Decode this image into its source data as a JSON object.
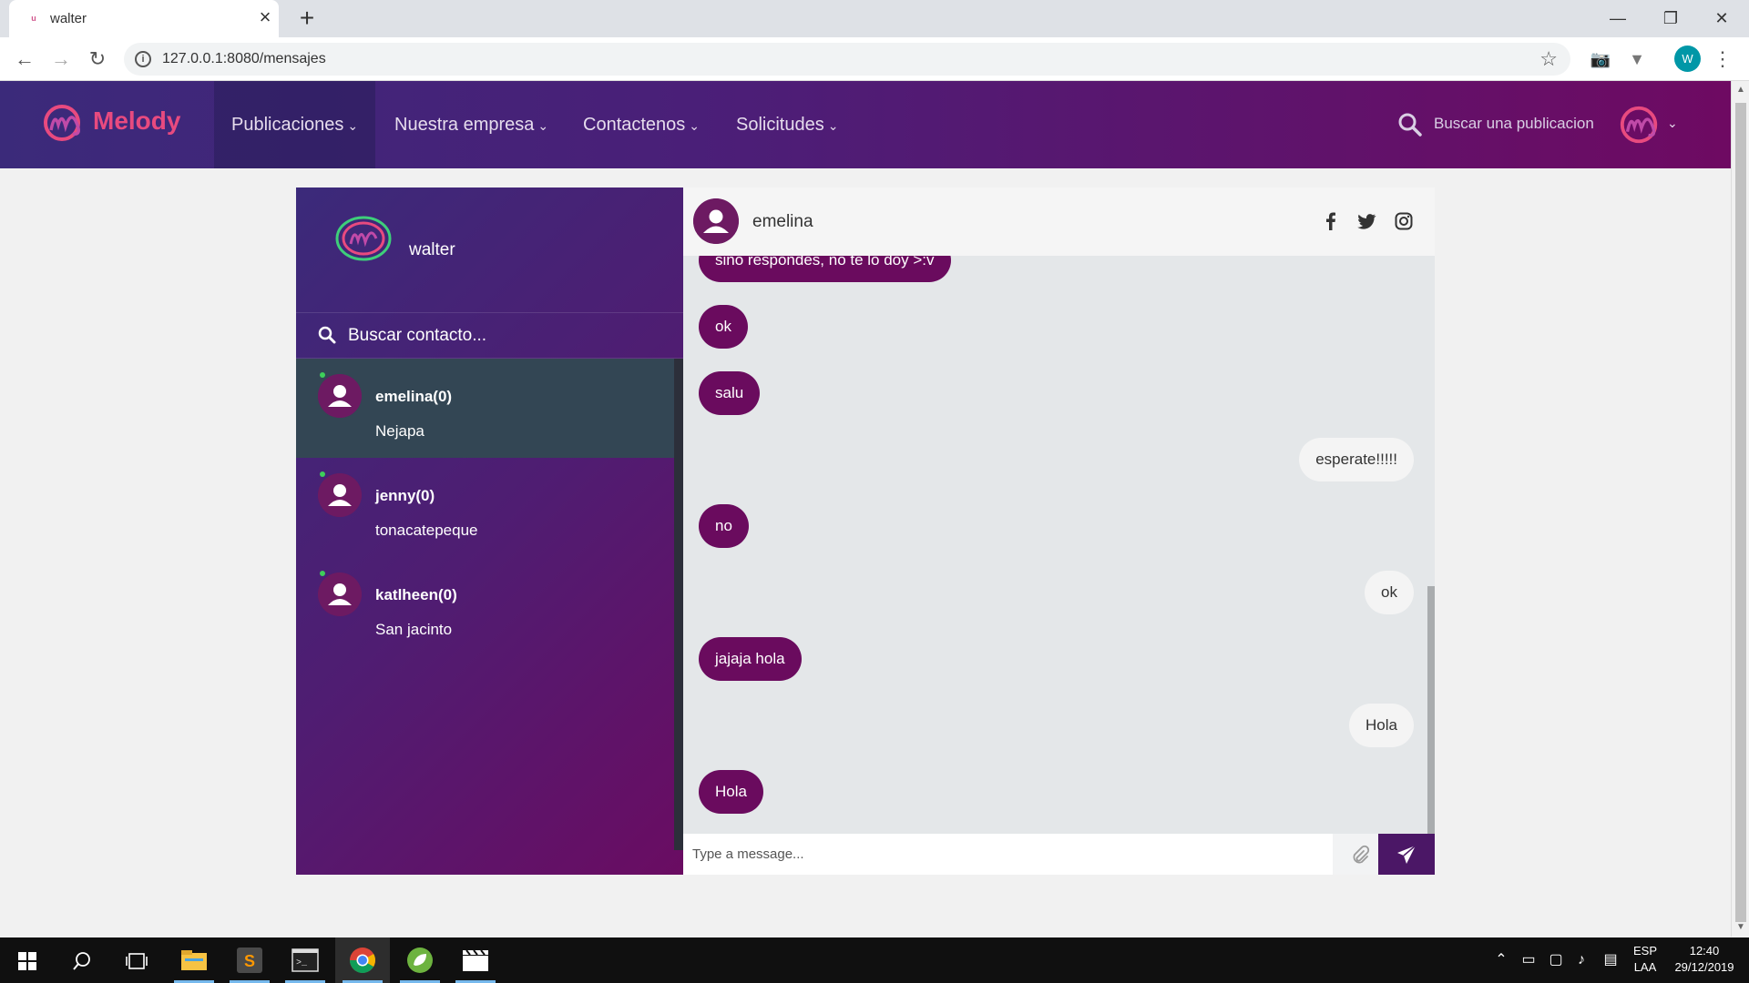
{
  "browser": {
    "tab_title": "walter",
    "tab_favicon_letter": "u",
    "url": "127.0.0.1:8080/mensajes",
    "profile_initial": "W"
  },
  "site": {
    "brand": "Melody",
    "menu": [
      {
        "label": "Publicaciones"
      },
      {
        "label": "Nuestra empresa"
      },
      {
        "label": "Contactenos"
      },
      {
        "label": "Solicitudes"
      }
    ],
    "search_placeholder": "Buscar una publicacion",
    "brand_color": "#e84a7f"
  },
  "chat": {
    "me": {
      "name": "walter"
    },
    "contact_search_placeholder": "Buscar contacto...",
    "contacts": [
      {
        "name": "emelina(0)",
        "location": "Nejapa",
        "online": true,
        "selected": true
      },
      {
        "name": "jenny(0)",
        "location": "tonacatepeque",
        "online": true,
        "selected": false
      },
      {
        "name": "katlheen(0)",
        "location": "San jacinto",
        "online": true,
        "selected": false
      }
    ],
    "active_contact": "emelina",
    "messages": [
      {
        "text": "sino respondes, no te lo doy >:v",
        "direction": "in"
      },
      {
        "text": "ok",
        "direction": "in"
      },
      {
        "text": "salu",
        "direction": "in"
      },
      {
        "text": "esperate!!!!!",
        "direction": "out"
      },
      {
        "text": "no",
        "direction": "in"
      },
      {
        "text": "ok",
        "direction": "out"
      },
      {
        "text": "jajaja hola",
        "direction": "in"
      },
      {
        "text": "Hola",
        "direction": "out"
      },
      {
        "text": "Hola",
        "direction": "in"
      }
    ],
    "composer_placeholder": "Type a message...",
    "social_icons": [
      "facebook-icon",
      "twitter-icon",
      "instagram-icon"
    ],
    "incoming_color": "#6a0b5e",
    "selected_contact_color": "#334654"
  },
  "taskbar": {
    "lang_line1": "ESP",
    "lang_line2": "LAA",
    "time": "12:40",
    "date": "29/12/2019"
  }
}
